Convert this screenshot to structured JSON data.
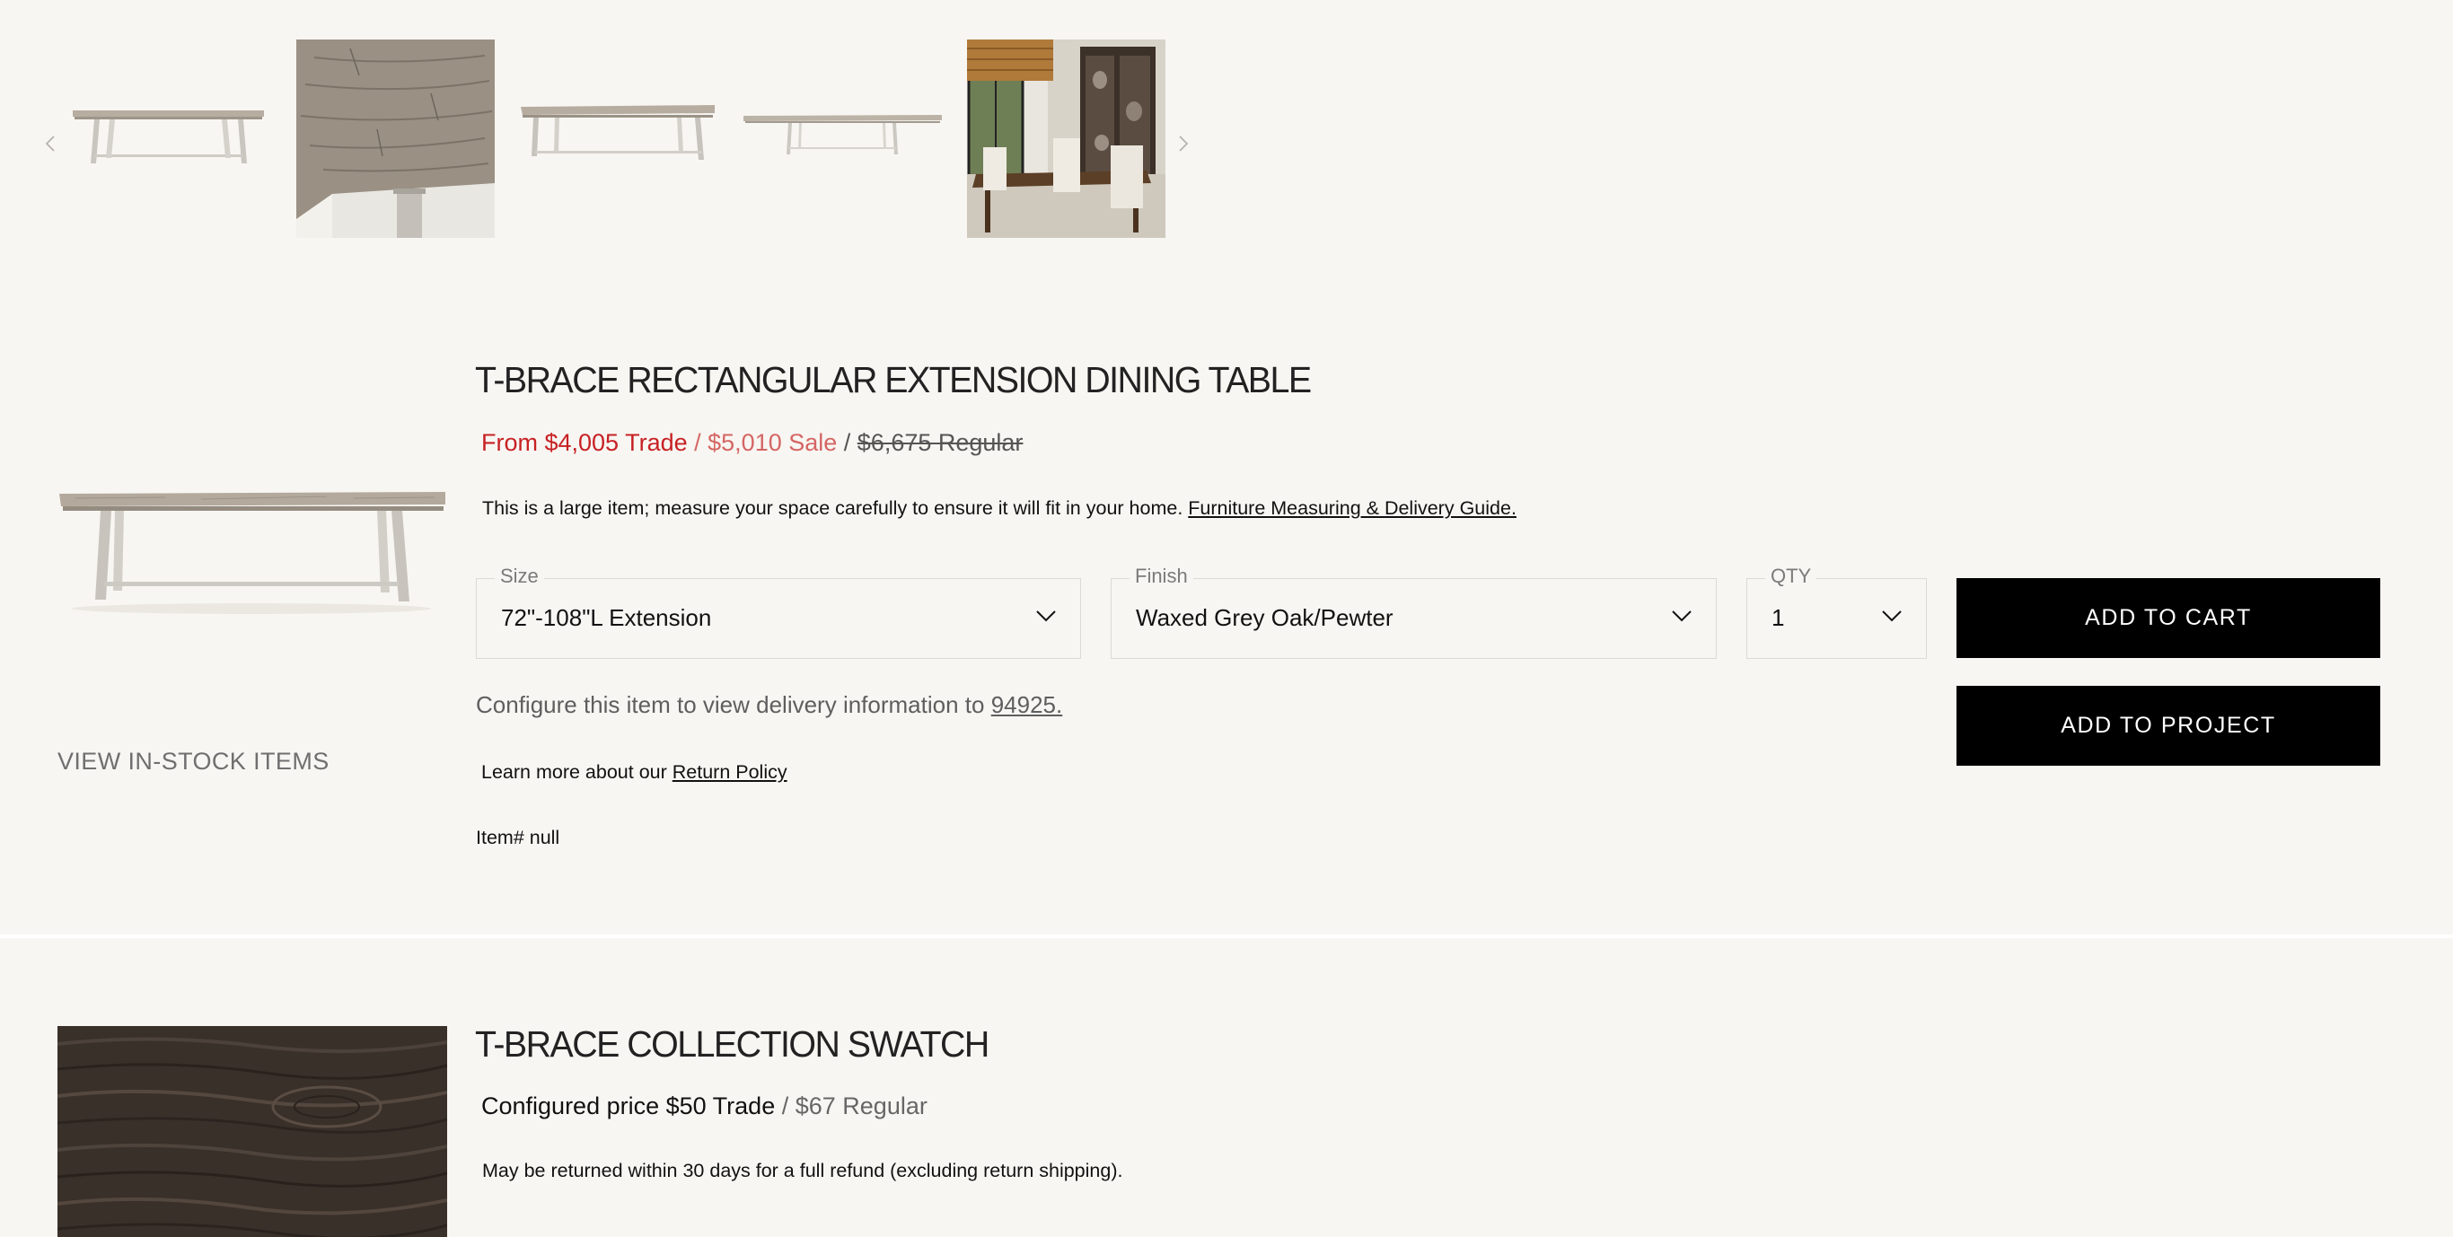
{
  "colors": {
    "background": "#f8f6f2",
    "trade_price": "#c72124",
    "sale_price": "#d46664",
    "button_bg": "#000000",
    "button_text": "#ffffff"
  },
  "carousel": {
    "prev_icon": "chevron-left-icon",
    "next_icon": "chevron-right-icon",
    "thumbnails": [
      "table-front-view",
      "table-top-corner-closeup",
      "table-angled-view",
      "table-extended-view",
      "dining-room-scene"
    ]
  },
  "product": {
    "title": "T-BRACE RECTANGULAR EXTENSION DINING TABLE",
    "price": {
      "trade": "From $4,005 Trade",
      "sep1": " / ",
      "sale": "$5,010 Sale",
      "sep2": " / ",
      "regular": "$6,675 Regular"
    },
    "notice_text": "This is a large item; measure your space carefully to ensure it will fit in your home. ",
    "notice_link": "Furniture Measuring & Delivery Guide.",
    "view_in_stock": "VIEW IN-STOCK ITEMS",
    "options": {
      "size": {
        "label": "Size",
        "value": "72\"-108\"L Extension"
      },
      "finish": {
        "label": "Finish",
        "value": "Waxed Grey Oak/Pewter"
      },
      "qty": {
        "label": "QTY",
        "value": "1"
      }
    },
    "add_to_cart": "ADD TO CART",
    "add_to_project": "ADD TO PROJECT",
    "delivery_text": "Configure this item to view delivery information to ",
    "delivery_zip": "94925.",
    "return_text": "Learn more about our ",
    "return_link": "Return Policy",
    "item_number": "Item# null"
  },
  "swatch": {
    "title": "T-BRACE COLLECTION SWATCH",
    "trade": "Configured price $50 Trade",
    "sep": " / ",
    "regular": "$67 Regular",
    "note": "May be returned within 30 days for a full refund (excluding return shipping)."
  }
}
